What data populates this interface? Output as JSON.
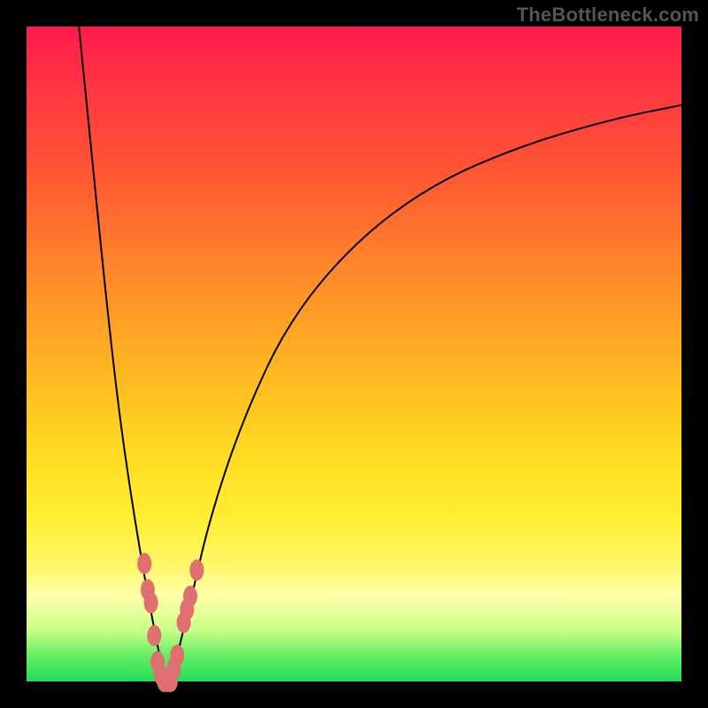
{
  "watermark": "TheBottleneck.com",
  "chart_data": {
    "type": "line",
    "title": "",
    "xlabel": "",
    "ylabel": "",
    "xlim": [
      0,
      100
    ],
    "ylim": [
      0,
      100
    ],
    "grid": false,
    "legend": false,
    "series": [
      {
        "name": "left-curve",
        "x": [
          8,
          10,
          12,
          14,
          16,
          18,
          19.5,
          20.5,
          21.5
        ],
        "values": [
          100,
          80,
          60,
          42,
          28,
          16,
          8,
          3,
          0
        ]
      },
      {
        "name": "right-curve",
        "x": [
          22,
          23,
          25,
          28,
          33,
          40,
          50,
          62,
          76,
          90,
          100
        ],
        "values": [
          0,
          4,
          12,
          25,
          40,
          55,
          67,
          76,
          82,
          86,
          88
        ]
      }
    ],
    "markers": [
      {
        "x": 18.0,
        "y": 18
      },
      {
        "x": 18.5,
        "y": 14
      },
      {
        "x": 19.0,
        "y": 12
      },
      {
        "x": 19.5,
        "y": 7
      },
      {
        "x": 20.0,
        "y": 3
      },
      {
        "x": 20.5,
        "y": 1
      },
      {
        "x": 21.0,
        "y": 0
      },
      {
        "x": 21.5,
        "y": 0
      },
      {
        "x": 22.0,
        "y": 0
      },
      {
        "x": 22.5,
        "y": 2
      },
      {
        "x": 23.0,
        "y": 4
      },
      {
        "x": 24.0,
        "y": 9
      },
      {
        "x": 24.5,
        "y": 11
      },
      {
        "x": 25.0,
        "y": 13
      },
      {
        "x": 26.0,
        "y": 17
      }
    ],
    "background_gradient": {
      "top": "#ff1a4d",
      "mid": "#ffdd22",
      "bottom": "#22dd55"
    }
  }
}
